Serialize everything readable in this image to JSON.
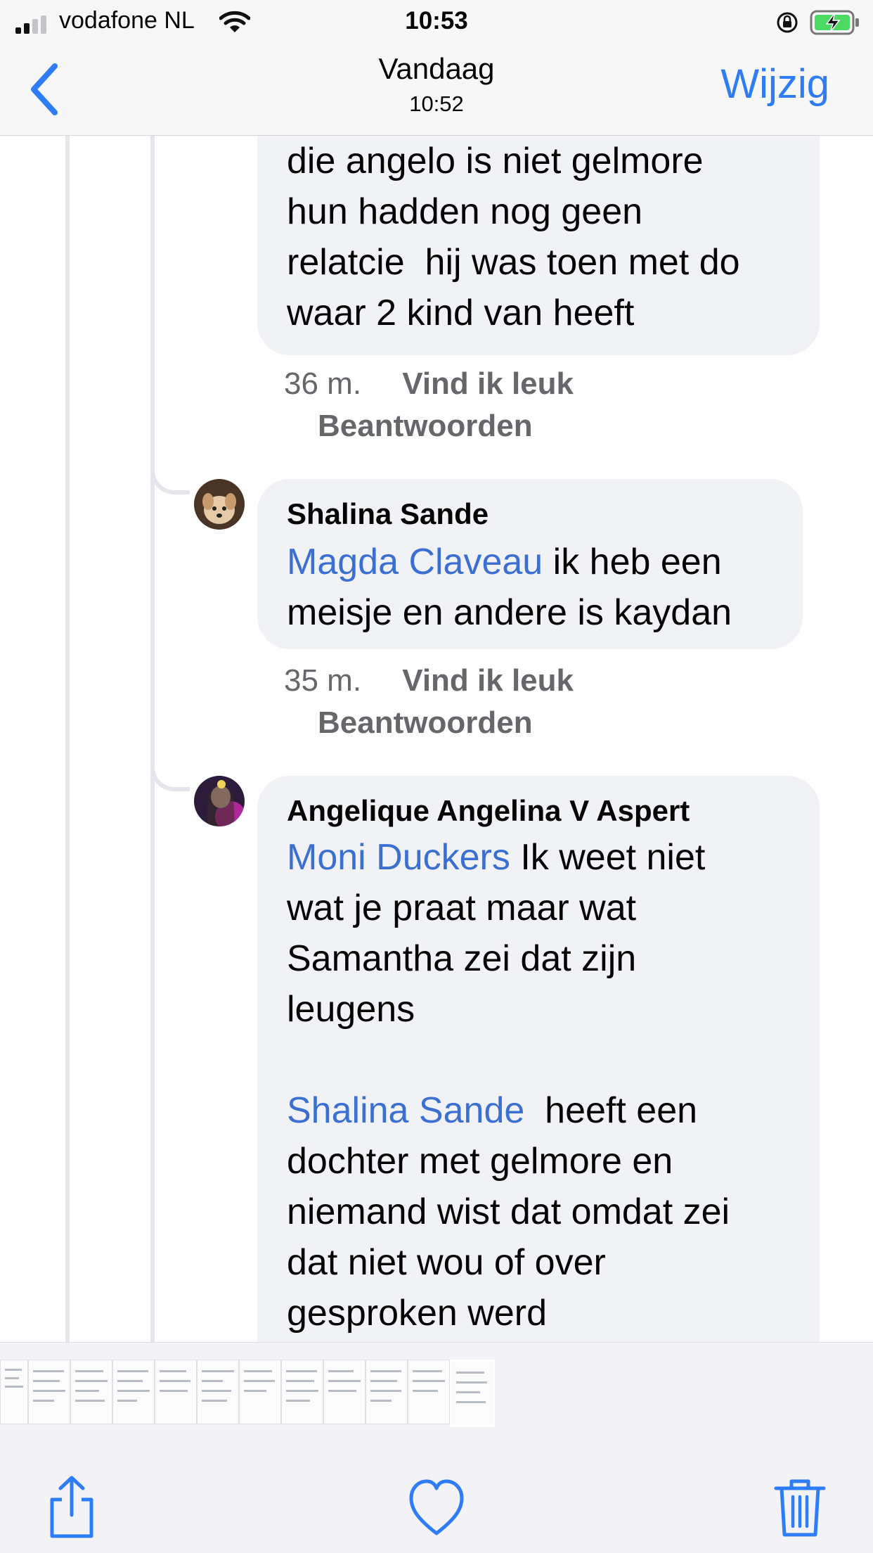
{
  "status_bar": {
    "carrier": "vodafone NL",
    "time": "10:53"
  },
  "nav": {
    "title": "Vandaag",
    "subtitle": "10:52",
    "edit_label": "Wijzig"
  },
  "comments": [
    {
      "author": "",
      "text_lines": [
        "die angelo is niet gelmore",
        "hun hadden nog geen",
        "relatcie  hij was toen met do",
        "waar 2 kind van heeft"
      ],
      "time": "36 m.",
      "like_label": "Vind ik leuk",
      "reply_label": "Beantwoorden"
    },
    {
      "author": "Shalina Sande",
      "mention": "Magda Claveau",
      "text_rest": " ik heb een",
      "text_line2": "meisje en andere is kaydan",
      "time": "35 m.",
      "like_label": "Vind ik leuk",
      "reply_label": "Beantwoorden"
    },
    {
      "author": "Angelique Angelina V Aspert",
      "mention": "Moni Duckers",
      "text_rest": " Ik weet niet",
      "text_lines": [
        "wat je praat maar wat",
        "Samantha zei dat zijn",
        "leugens"
      ],
      "mention2": "Shalina Sande",
      "text_rest2": "  heeft een",
      "text_lines2": [
        "dochter met gelmore en",
        "niemand wist dat omdat zei",
        "dat niet wou of over",
        "gesproken werd"
      ]
    }
  ],
  "toolbar": {
    "share_icon": "share-icon",
    "favorite_icon": "heart-icon",
    "delete_icon": "trash-icon"
  },
  "colors": {
    "accent": "#2e7cf6",
    "mention": "#3b6fd1",
    "bubble": "#f0f2f5",
    "meta": "#65676b"
  }
}
